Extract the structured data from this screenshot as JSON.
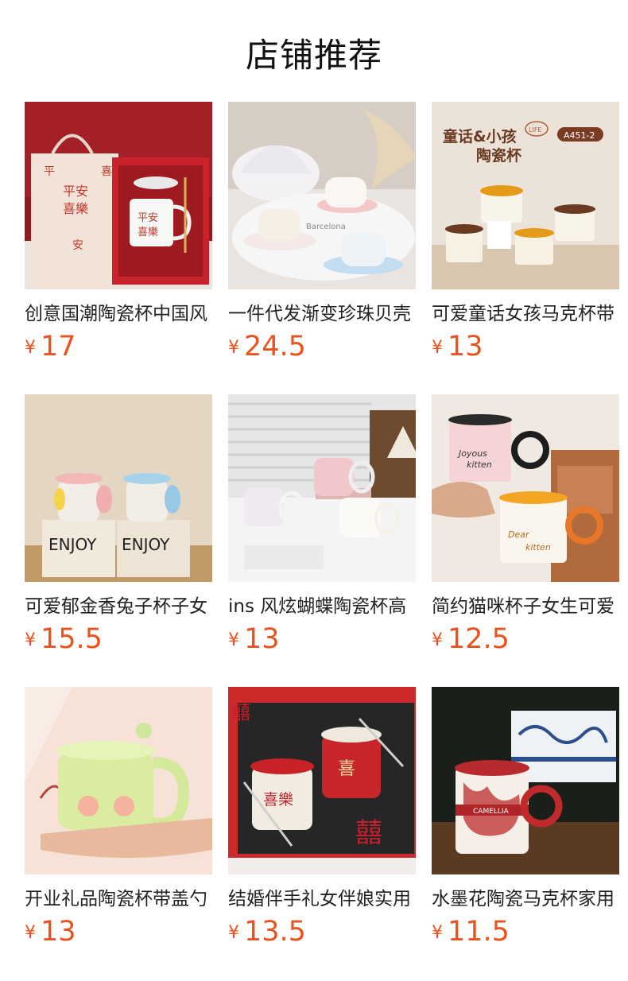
{
  "header": {
    "title": "店铺推荐"
  },
  "currency_symbol": "¥",
  "colors": {
    "price": "#e8531e",
    "text": "#222222",
    "background": "#ffffff"
  },
  "products": [
    {
      "name": "创意国潮陶瓷杯中国风",
      "price": "17",
      "photo_text": [
        "平安",
        "喜樂",
        "平",
        "喜",
        "安"
      ]
    },
    {
      "name": "一件代发渐变珍珠贝壳",
      "price": "24.5",
      "photo_text": [
        "Barcelona"
      ]
    },
    {
      "name": "可爱童话女孩马克杯带",
      "price": "13",
      "photo_text": [
        "童话&小孩",
        "陶瓷杯",
        "A451-2",
        "LIFE"
      ]
    },
    {
      "name": "可爱郁金香兔子杯子女",
      "price": "15.5",
      "photo_text": [
        "ENJOY",
        "ENJOY"
      ]
    },
    {
      "name": "ins 风炫蝴蝶陶瓷杯高",
      "price": "13",
      "photo_text": []
    },
    {
      "name": "简约猫咪杯子女生可爱",
      "price": "12.5",
      "photo_text": [
        "Joyous",
        "kitten",
        "Dear",
        "kitten"
      ]
    },
    {
      "name": "开业礼品陶瓷杯带盖勺",
      "price": "13",
      "photo_text": []
    },
    {
      "name": "结婚伴手礼女伴娘实用",
      "price": "13.5",
      "photo_text": [
        "囍",
        "喜樂",
        "喜",
        "囍"
      ]
    },
    {
      "name": "水墨花陶瓷马克杯家用",
      "price": "11.5",
      "photo_text": [
        "CAMELLIA"
      ]
    }
  ]
}
